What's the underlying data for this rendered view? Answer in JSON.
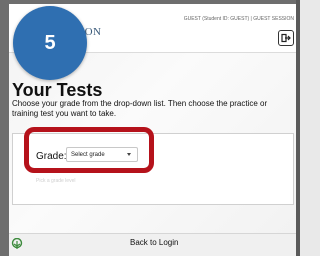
{
  "header": {
    "logo_text": "SON",
    "logo_sub": "",
    "user_info": "GUEST (Student ID: GUEST) | GUEST SESSION",
    "logout_icon": "logout-icon"
  },
  "step": {
    "number": "5",
    "color": "#2f6fb1"
  },
  "main": {
    "title": "Your Tests",
    "instructions": "Choose your grade from the drop-down list. Then choose the practice or training test you want to take.",
    "grade_label": "Grade:",
    "grade_select_value": "Select grade",
    "faded_note": "Pick a grade level"
  },
  "footer": {
    "back_label": "Back to Login",
    "logo_icon": "tree-logo-icon"
  },
  "colors": {
    "highlight": "#b5121b",
    "badge": "#2f6fb1"
  }
}
